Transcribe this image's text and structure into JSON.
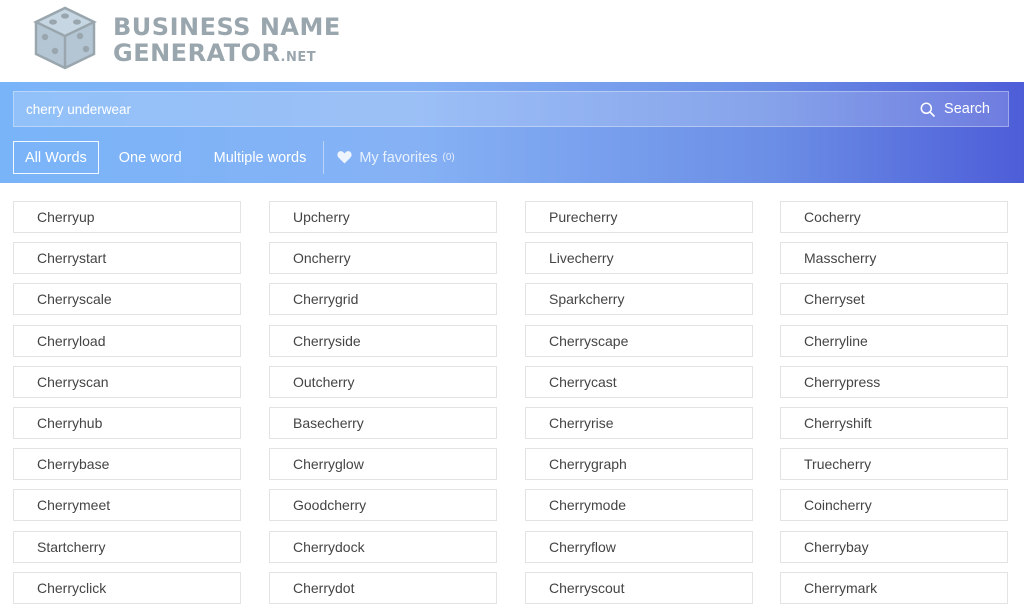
{
  "logo": {
    "line1": "BUSINESS NAME",
    "line2": "GENERATOR",
    "suffix": ".NET"
  },
  "search": {
    "value": "cherry underwear",
    "button_label": "Search"
  },
  "tabs": {
    "all_words": "All Words",
    "one_word": "One word",
    "multiple_words": "Multiple words",
    "favorites": "My favorites",
    "favorites_count": "(0)"
  },
  "results": [
    [
      "Cherryup",
      "Upcherry",
      "Purecherry",
      "Cocherry"
    ],
    [
      "Cherrystart",
      "Oncherry",
      "Livecherry",
      "Masscherry"
    ],
    [
      "Cherryscale",
      "Cherrygrid",
      "Sparkcherry",
      "Cherryset"
    ],
    [
      "Cherryload",
      "Cherryside",
      "Cherryscape",
      "Cherryline"
    ],
    [
      "Cherryscan",
      "Outcherry",
      "Cherrycast",
      "Cherrypress"
    ],
    [
      "Cherryhub",
      "Basecherry",
      "Cherryrise",
      "Cherryshift"
    ],
    [
      "Cherrybase",
      "Cherryglow",
      "Cherrygraph",
      "Truecherry"
    ],
    [
      "Cherrymeet",
      "Goodcherry",
      "Cherrymode",
      "Coincherry"
    ],
    [
      "Startcherry",
      "Cherrydock",
      "Cherryflow",
      "Cherrybay"
    ],
    [
      "Cherryclick",
      "Cherrydot",
      "Cherryscout",
      "Cherrymark"
    ]
  ],
  "colors": {
    "band_start": "#7ab4f8",
    "band_end": "#4d5dd8",
    "logo_gray": "#9aa6ad",
    "card_border": "#e3e3e3",
    "card_text": "#444444"
  }
}
